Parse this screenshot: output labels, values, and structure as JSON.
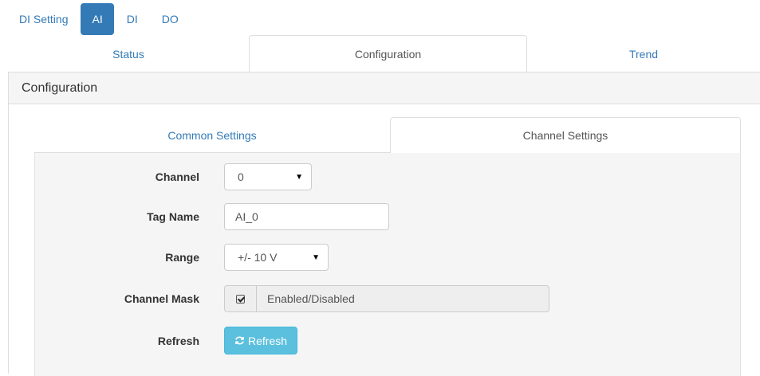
{
  "topnav": {
    "items": [
      {
        "label": "DI Setting",
        "active": false
      },
      {
        "label": "AI",
        "active": true
      },
      {
        "label": "DI",
        "active": false
      },
      {
        "label": "DO",
        "active": false
      }
    ]
  },
  "main_tabs": [
    {
      "label": "Status",
      "active": false
    },
    {
      "label": "Configuration",
      "active": true
    },
    {
      "label": "Trend",
      "active": false
    }
  ],
  "panel": {
    "heading": "Configuration"
  },
  "sub_tabs": [
    {
      "label": "Common Settings",
      "active": false
    },
    {
      "label": "Channel Settings",
      "active": true
    }
  ],
  "form": {
    "channel": {
      "label": "Channel",
      "value": "0"
    },
    "tag_name": {
      "label": "Tag Name",
      "value": "AI_0"
    },
    "range": {
      "label": "Range",
      "value": "+/- 10 V"
    },
    "channel_mask": {
      "label": "Channel Mask",
      "checked": true,
      "text": "Enabled/Disabled"
    },
    "refresh": {
      "label": "Refresh",
      "button_label": "Refresh"
    }
  },
  "colors": {
    "accent": "#337ab7",
    "info_button": "#5bc0de"
  }
}
